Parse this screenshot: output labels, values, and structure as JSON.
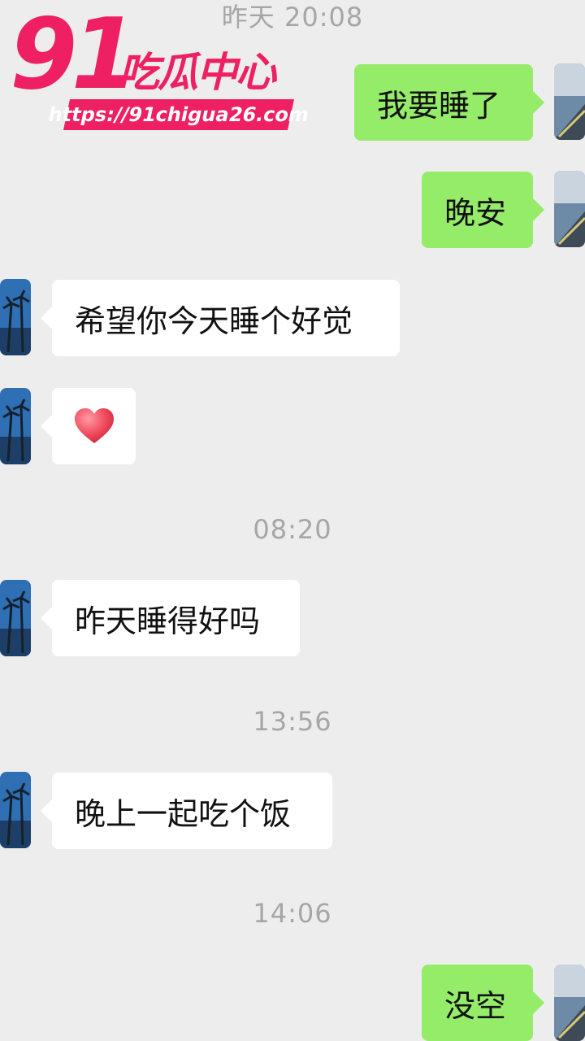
{
  "watermark": {
    "number": "91",
    "name": "吃瓜中心",
    "url": "https://91chigua26.com"
  },
  "timestamps": [
    "昨天 20:08",
    "08:20",
    "13:56",
    "14:06"
  ],
  "messages": {
    "m1": "我要睡了",
    "m2": "晚安",
    "m3": "希望你今天睡个好觉",
    "m4": "",
    "m5": "昨天睡得好吗",
    "m6": "晚上一起吃个饭",
    "m7": "没空"
  },
  "m4_emoji": "red-heart",
  "colors": {
    "background": "#ededed",
    "outgoing_bubble": "#95ec69",
    "incoming_bubble": "#ffffff",
    "timestamp": "#a6a6a6",
    "watermark": "#ee1f63"
  }
}
